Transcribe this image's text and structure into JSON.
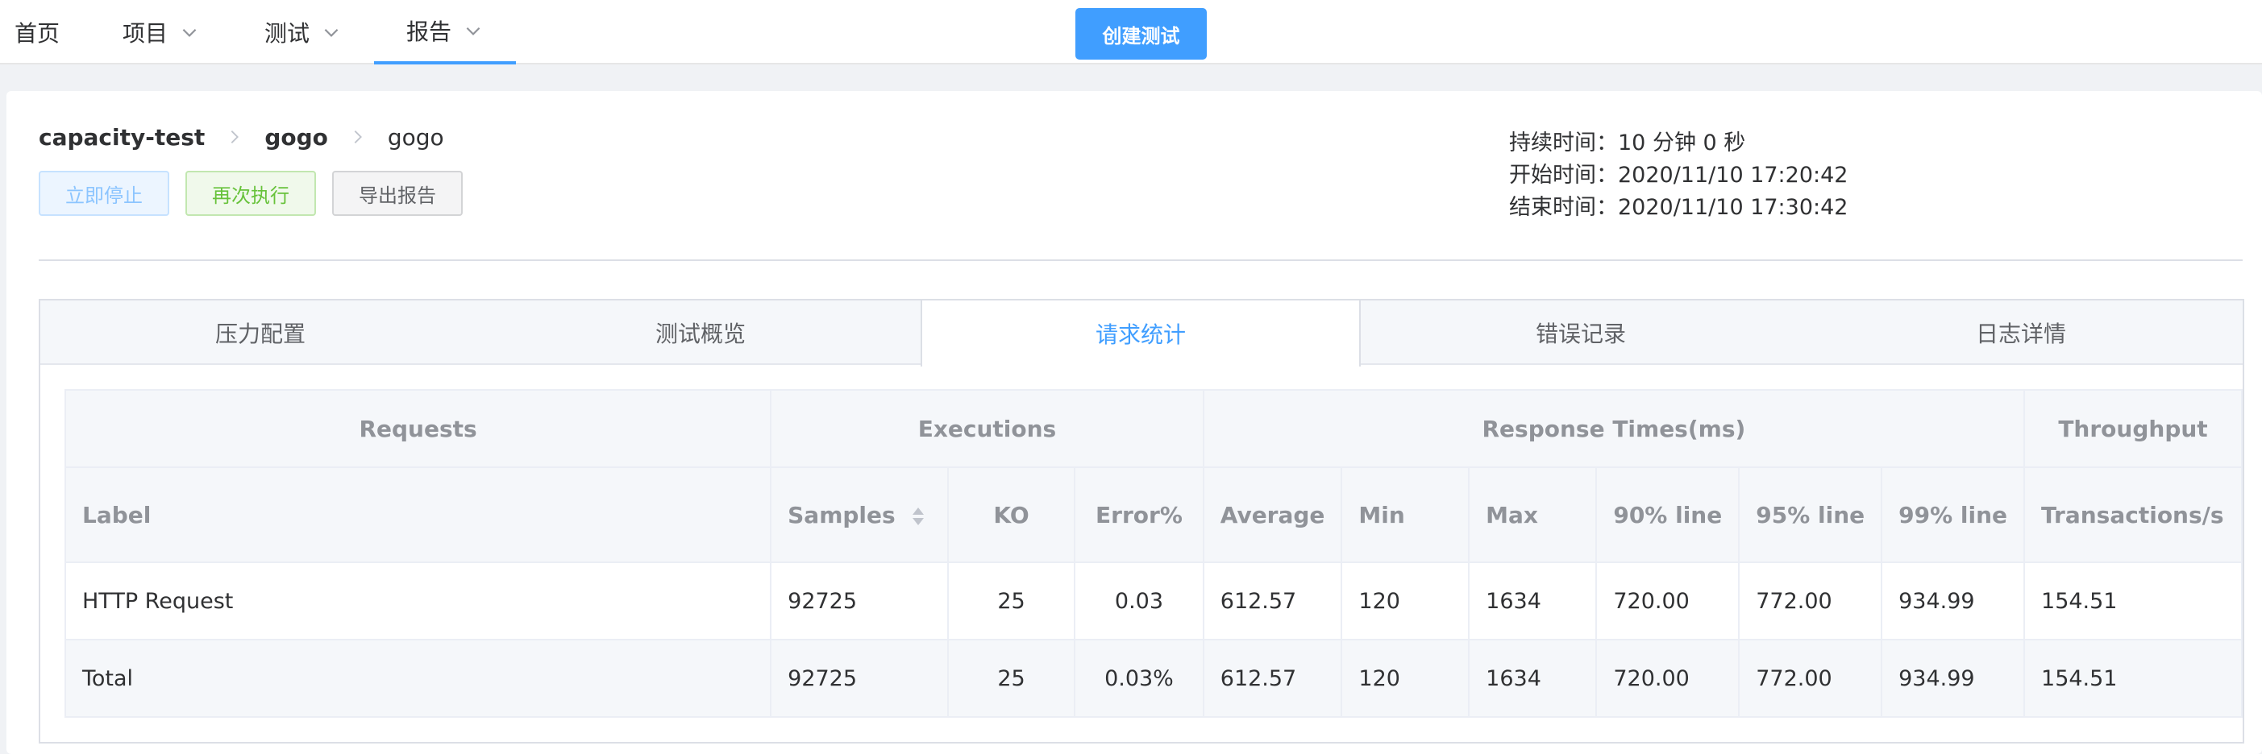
{
  "nav": {
    "items": [
      {
        "label": "首页",
        "has_dropdown": false
      },
      {
        "label": "项目",
        "has_dropdown": true
      },
      {
        "label": "测试",
        "has_dropdown": true
      },
      {
        "label": "报告",
        "has_dropdown": true,
        "active": true
      }
    ],
    "create_button": "创建测试"
  },
  "breadcrumb": [
    "capacity-test",
    "gogo",
    "gogo"
  ],
  "actions": {
    "stop": "立即停止",
    "rerun": "再次执行",
    "export": "导出报告"
  },
  "meta": {
    "duration": "持续时间：10 分钟 0 秒",
    "start": "开始时间：2020/11/10 17:20:42",
    "end": "结束时间：2020/11/10 17:30:42"
  },
  "tabs": [
    "压力配置",
    "测试概览",
    "请求统计",
    "错误记录",
    "日志详情"
  ],
  "active_tab": "请求统计",
  "table": {
    "groups": [
      "Requests",
      "Executions",
      "Response Times(ms)",
      "Throughput"
    ],
    "columns": [
      "Label",
      "Samples",
      "KO",
      "Error%",
      "Average",
      "Min",
      "Max",
      "90% line",
      "95% line",
      "99% line",
      "Transactions/s"
    ],
    "rows": [
      [
        "HTTP Request",
        "92725",
        "25",
        "0.03",
        "612.57",
        "120",
        "1634",
        "720.00",
        "772.00",
        "934.99",
        "154.51"
      ],
      [
        "Total",
        "92725",
        "25",
        "0.03%",
        "612.57",
        "120",
        "1634",
        "720.00",
        "772.00",
        "934.99",
        "154.51"
      ]
    ]
  },
  "colors": {
    "primary": "#409eff",
    "success": "#67c23a",
    "nav_border": "#409eff"
  }
}
